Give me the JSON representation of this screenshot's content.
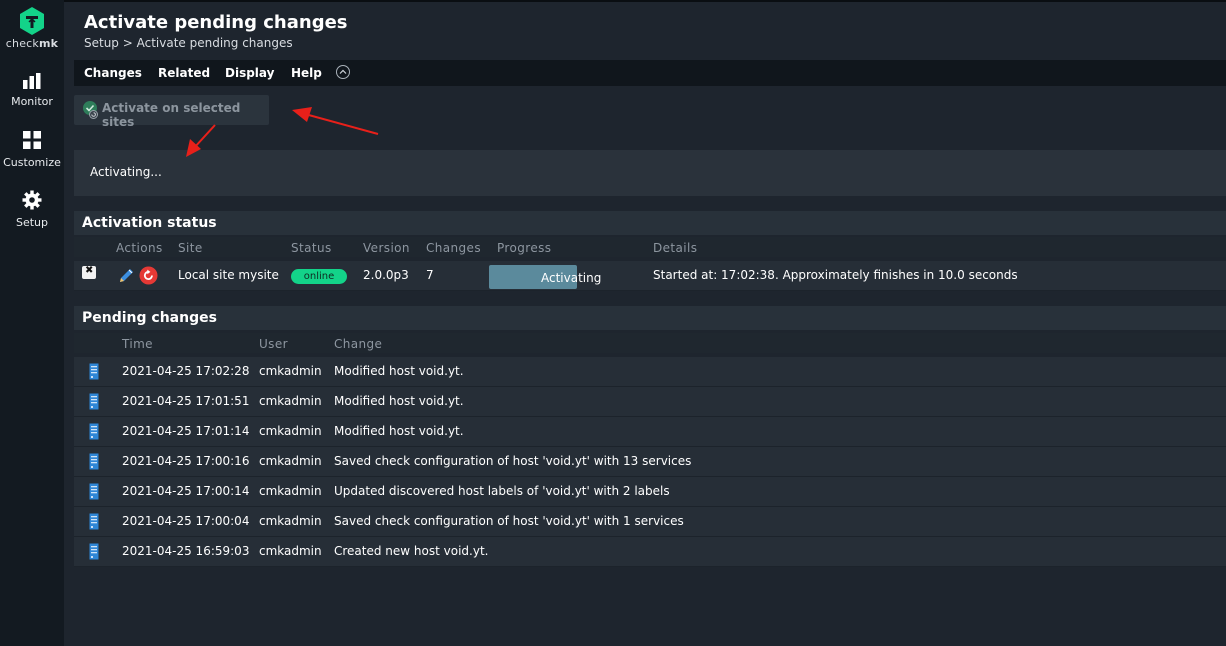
{
  "brand": {
    "logo_text_regular": "check",
    "logo_text_bold": "mk",
    "accent_color": "#13d389"
  },
  "sidebar": {
    "items": [
      {
        "label": "Monitor",
        "icon": "bar-chart-icon"
      },
      {
        "label": "Customize",
        "icon": "grid-icon"
      },
      {
        "label": "Setup",
        "icon": "gear-icon"
      }
    ]
  },
  "header": {
    "title": "Activate pending changes",
    "breadcrumb": "Setup > Activate pending changes"
  },
  "menu": {
    "items": [
      "Changes",
      "Related",
      "Display",
      "Help"
    ],
    "collapse_icon": "chevron-up-icon"
  },
  "toolbar": {
    "activate_label": "Activate on selected sites",
    "activate_icon": "check-circle-icon"
  },
  "message": {
    "text": "Activating..."
  },
  "activation_status": {
    "title": "Activation status",
    "columns": [
      "Actions",
      "Site",
      "Status",
      "Version",
      "Changes",
      "Progress",
      "Details"
    ],
    "rows": [
      {
        "site": "Local site mysite",
        "status": "online",
        "version": "2.0.0p3",
        "changes": "7",
        "progress_label": "Activating",
        "progress_fraction": 0.55,
        "details": "Started at: 17:02:38. Approximately finishes in 10.0 seconds"
      }
    ]
  },
  "pending_changes": {
    "title": "Pending changes",
    "columns": [
      "Time",
      "User",
      "Change"
    ],
    "rows": [
      {
        "time": "2021-04-25 17:02:28",
        "user": "cmkadmin",
        "change": "Modified host void.yt."
      },
      {
        "time": "2021-04-25 17:01:51",
        "user": "cmkadmin",
        "change": "Modified host void.yt."
      },
      {
        "time": "2021-04-25 17:01:14",
        "user": "cmkadmin",
        "change": "Modified host void.yt."
      },
      {
        "time": "2021-04-25 17:00:16",
        "user": "cmkadmin",
        "change": "Saved check configuration of host 'void.yt' with 13 services"
      },
      {
        "time": "2021-04-25 17:00:14",
        "user": "cmkadmin",
        "change": "Updated discovered host labels of 'void.yt' with 2 labels"
      },
      {
        "time": "2021-04-25 17:00:04",
        "user": "cmkadmin",
        "change": "Saved check configuration of host 'void.yt' with 1 services"
      },
      {
        "time": "2021-04-25 16:59:03",
        "user": "cmkadmin",
        "change": "Created new host void.yt."
      }
    ]
  },
  "annotation_color": "#e8201a"
}
